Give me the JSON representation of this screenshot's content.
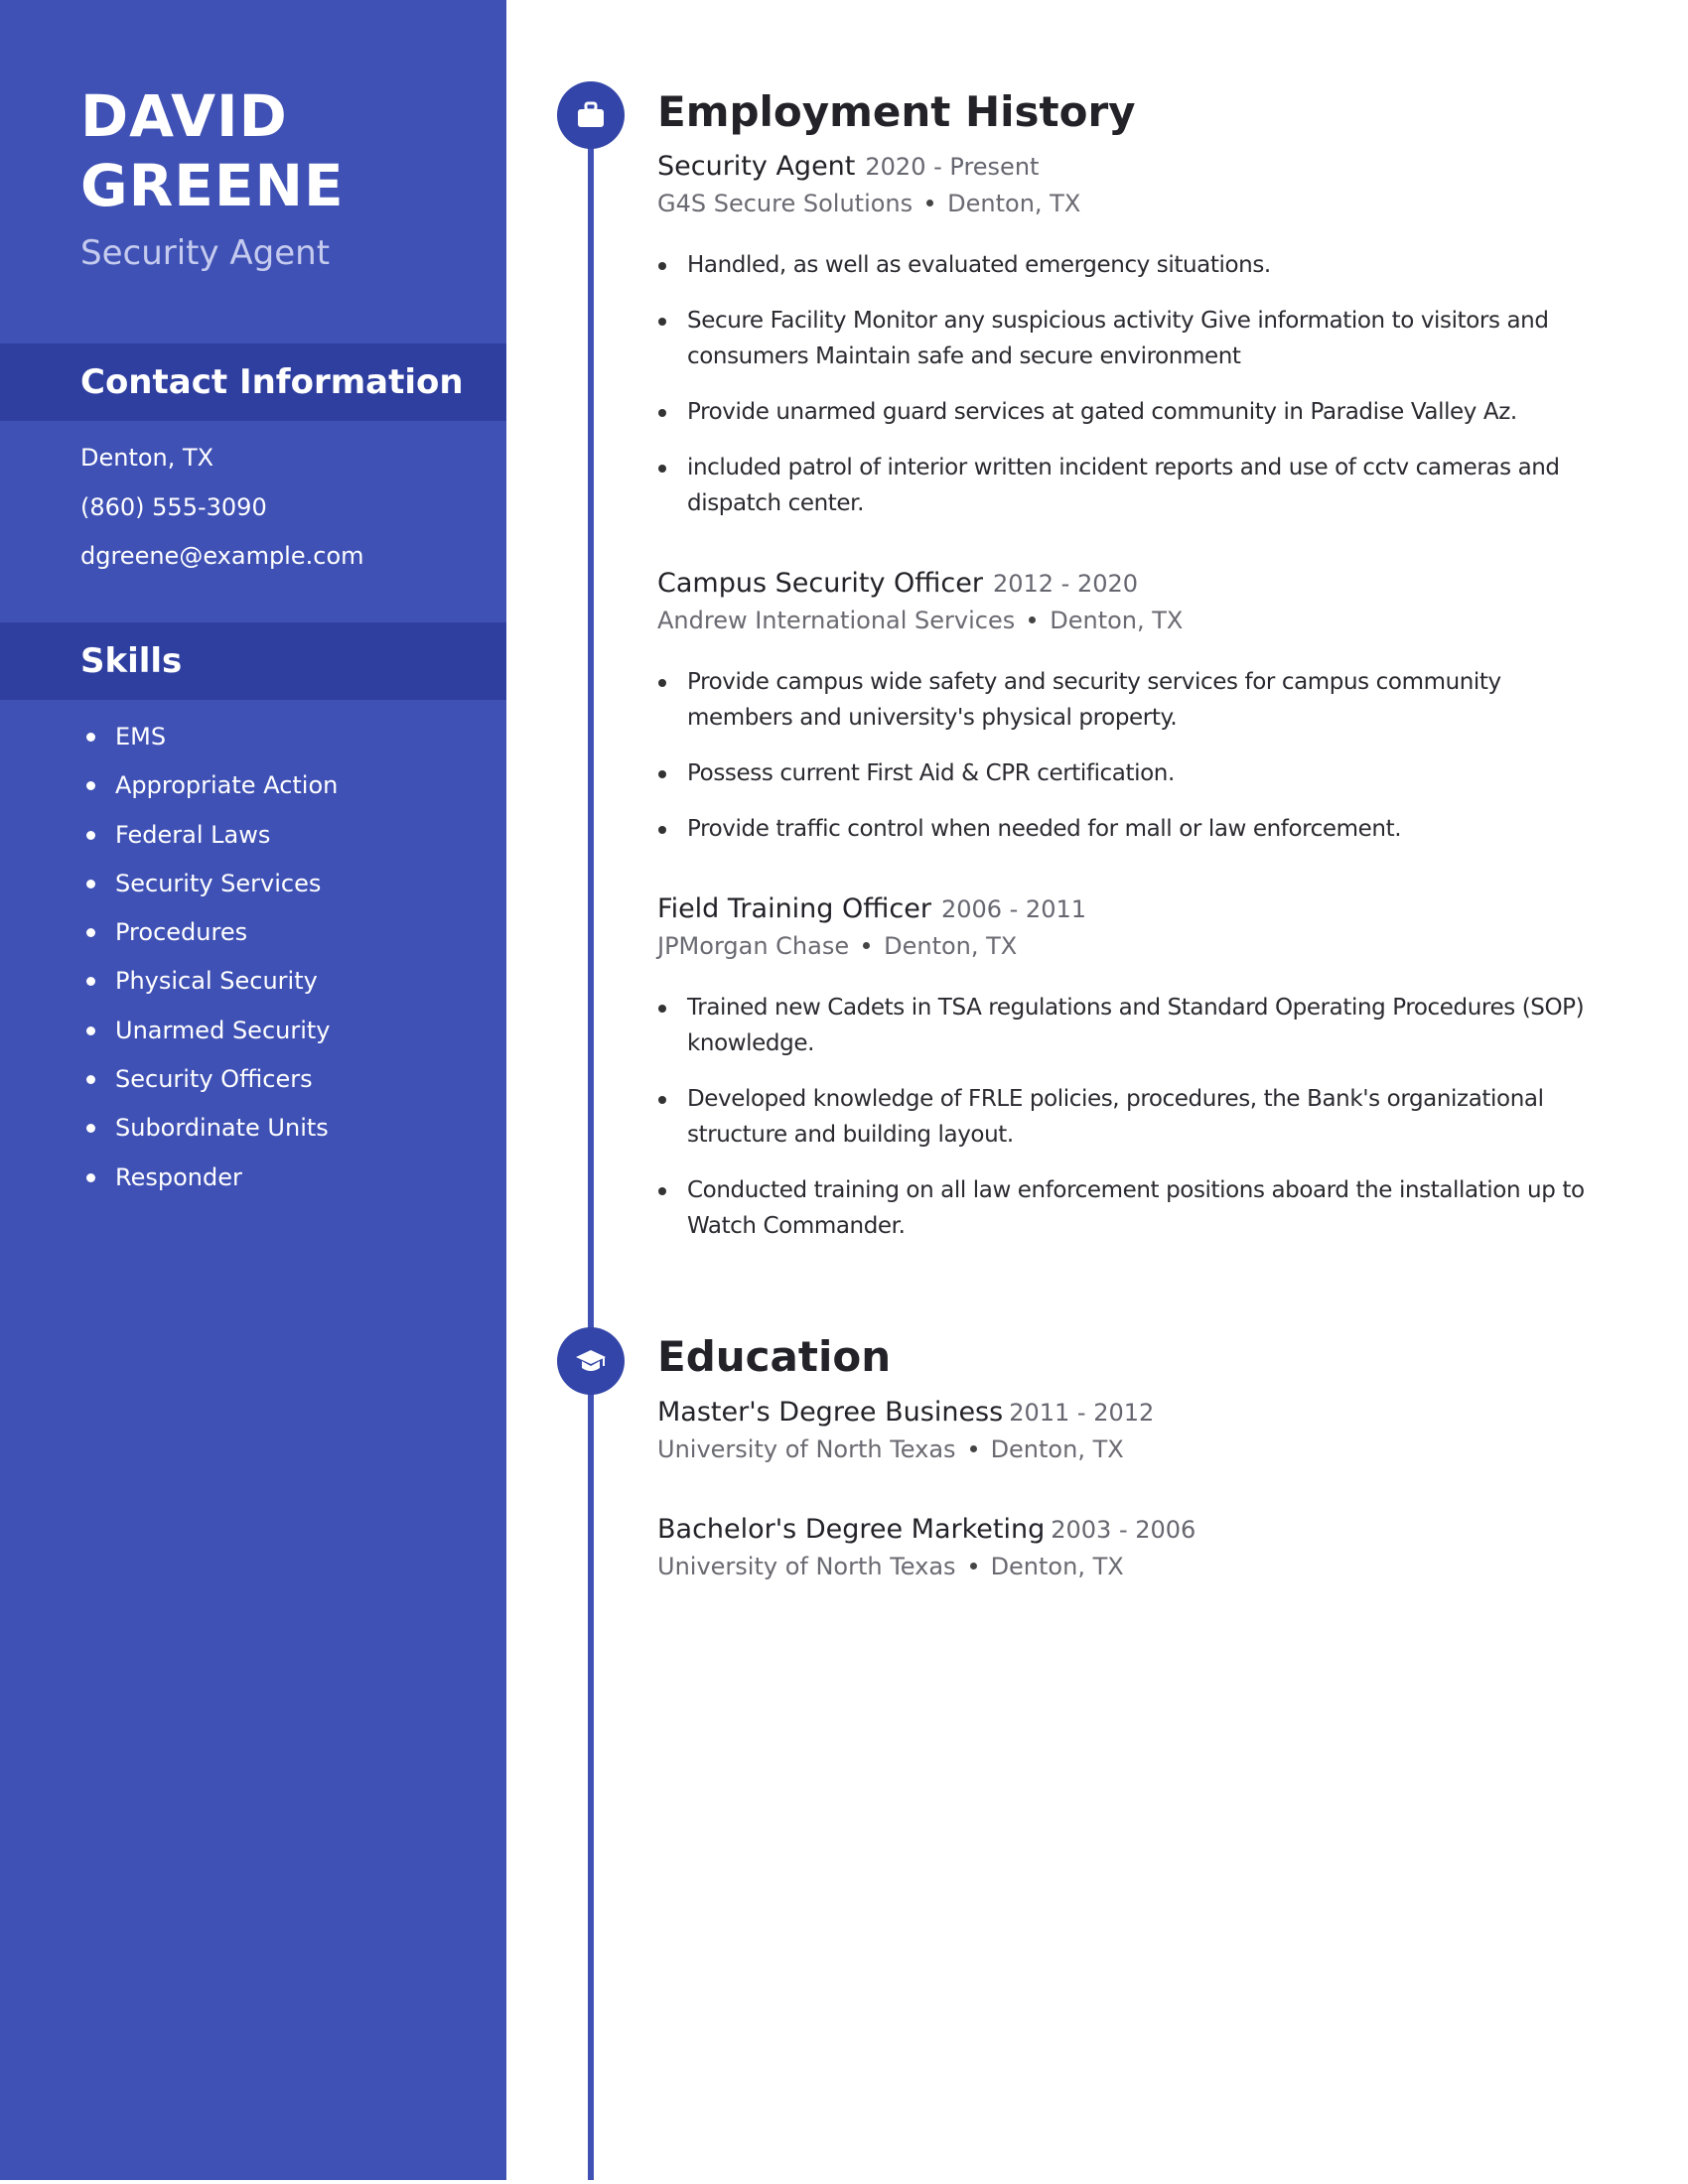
{
  "colors": {
    "sidebar": "#3f51b5",
    "sidebar_header": "#2f3fa0",
    "accent": "#3345a8",
    "text": "#222228",
    "muted": "#6a6a72"
  },
  "profile": {
    "first_name": "DAVID",
    "last_name": "GREENE",
    "title": "Security Agent"
  },
  "contact": {
    "heading": "Contact Information",
    "location": "Denton, TX",
    "phone": "(860) 555-3090",
    "email": "dgreene@example.com"
  },
  "skills": {
    "heading": "Skills",
    "items": [
      "EMS",
      "Appropriate Action",
      "Federal Laws",
      "Security Services",
      "Procedures",
      "Physical Security",
      "Unarmed Security",
      "Security Officers",
      "Subordinate Units",
      "Responder"
    ]
  },
  "employment": {
    "heading": "Employment History",
    "icon": "briefcase-icon",
    "jobs": [
      {
        "role": "Security Agent",
        "dates": "2020 - Present",
        "company": "G4S Secure Solutions",
        "location": "Denton, TX",
        "bullets": [
          "Handled, as well as evaluated emergency situations.",
          "Secure Facility Monitor any suspicious activity Give information to visitors and consumers Maintain safe and secure environment",
          "Provide unarmed guard services at gated community in Paradise Valley Az.",
          "included patrol of interior written incident reports and use of cctv cameras and dispatch center."
        ]
      },
      {
        "role": "Campus Security Officer",
        "dates": "2012 - 2020",
        "company": "Andrew International Services",
        "location": "Denton, TX",
        "bullets": [
          "Provide campus wide safety and security services for campus community members and university's physical property.",
          "Possess current First Aid & CPR certification.",
          "Provide traffic control when needed for mall or law enforcement."
        ]
      },
      {
        "role": "Field Training Officer",
        "dates": "2006 - 2011",
        "company": "JPMorgan Chase",
        "location": "Denton, TX",
        "bullets": [
          "Trained new Cadets in TSA regulations and Standard Operating Procedures (SOP) knowledge.",
          "Developed knowledge of FRLE policies, procedures, the Bank's organizational structure and building layout.",
          "Conducted training on all law enforcement positions aboard the installation up to Watch Commander."
        ]
      }
    ]
  },
  "education": {
    "heading": "Education",
    "icon": "graduation-cap-icon",
    "entries": [
      {
        "degree": "Master's Degree Business",
        "dates": "2011 - 2012",
        "school": "University of North Texas",
        "location": "Denton, TX"
      },
      {
        "degree": "Bachelor's Degree Marketing",
        "dates": "2003 - 2006",
        "school": "University of North Texas",
        "location": "Denton, TX"
      }
    ]
  }
}
